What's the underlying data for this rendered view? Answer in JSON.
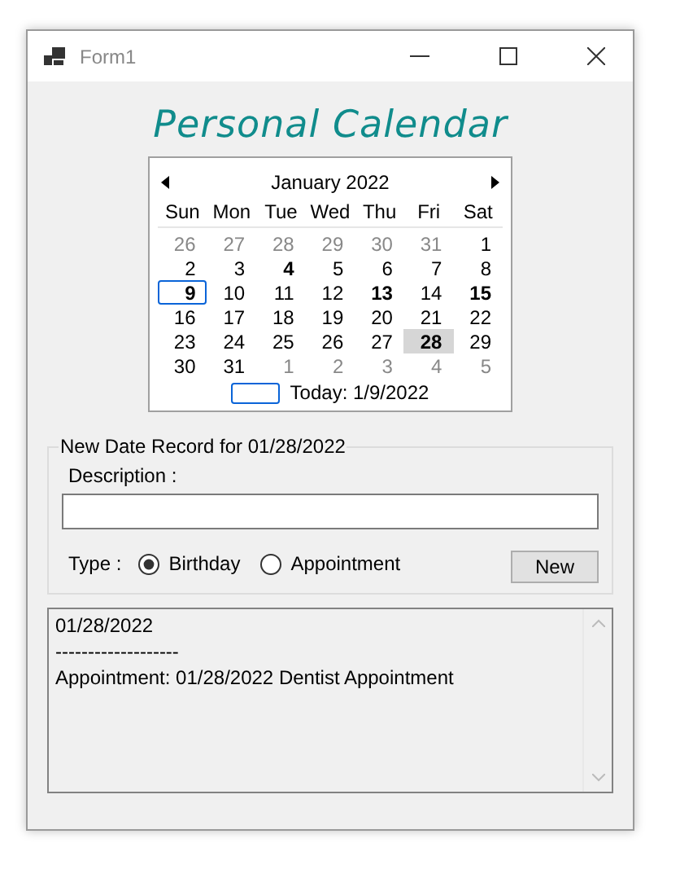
{
  "window": {
    "title": "Form1"
  },
  "heading": "Personal Calendar",
  "calendar": {
    "month": "January 2022",
    "weekdays": [
      "Sun",
      "Mon",
      "Tue",
      "Wed",
      "Thu",
      "Fri",
      "Sat"
    ],
    "days": [
      {
        "label": "26",
        "other_month": true,
        "bold": false,
        "today": false,
        "selected": false
      },
      {
        "label": "27",
        "other_month": true,
        "bold": false,
        "today": false,
        "selected": false
      },
      {
        "label": "28",
        "other_month": true,
        "bold": false,
        "today": false,
        "selected": false
      },
      {
        "label": "29",
        "other_month": true,
        "bold": false,
        "today": false,
        "selected": false
      },
      {
        "label": "30",
        "other_month": true,
        "bold": false,
        "today": false,
        "selected": false
      },
      {
        "label": "31",
        "other_month": true,
        "bold": false,
        "today": false,
        "selected": false
      },
      {
        "label": "1",
        "other_month": false,
        "bold": false,
        "today": false,
        "selected": false
      },
      {
        "label": "2",
        "other_month": false,
        "bold": false,
        "today": false,
        "selected": false
      },
      {
        "label": "3",
        "other_month": false,
        "bold": false,
        "today": false,
        "selected": false
      },
      {
        "label": "4",
        "other_month": false,
        "bold": true,
        "today": false,
        "selected": false
      },
      {
        "label": "5",
        "other_month": false,
        "bold": false,
        "today": false,
        "selected": false
      },
      {
        "label": "6",
        "other_month": false,
        "bold": false,
        "today": false,
        "selected": false
      },
      {
        "label": "7",
        "other_month": false,
        "bold": false,
        "today": false,
        "selected": false
      },
      {
        "label": "8",
        "other_month": false,
        "bold": false,
        "today": false,
        "selected": false
      },
      {
        "label": "9",
        "other_month": false,
        "bold": true,
        "today": true,
        "selected": false
      },
      {
        "label": "10",
        "other_month": false,
        "bold": false,
        "today": false,
        "selected": false
      },
      {
        "label": "11",
        "other_month": false,
        "bold": false,
        "today": false,
        "selected": false
      },
      {
        "label": "12",
        "other_month": false,
        "bold": false,
        "today": false,
        "selected": false
      },
      {
        "label": "13",
        "other_month": false,
        "bold": true,
        "today": false,
        "selected": false
      },
      {
        "label": "14",
        "other_month": false,
        "bold": false,
        "today": false,
        "selected": false
      },
      {
        "label": "15",
        "other_month": false,
        "bold": true,
        "today": false,
        "selected": false
      },
      {
        "label": "16",
        "other_month": false,
        "bold": false,
        "today": false,
        "selected": false
      },
      {
        "label": "17",
        "other_month": false,
        "bold": false,
        "today": false,
        "selected": false
      },
      {
        "label": "18",
        "other_month": false,
        "bold": false,
        "today": false,
        "selected": false
      },
      {
        "label": "19",
        "other_month": false,
        "bold": false,
        "today": false,
        "selected": false
      },
      {
        "label": "20",
        "other_month": false,
        "bold": false,
        "today": false,
        "selected": false
      },
      {
        "label": "21",
        "other_month": false,
        "bold": false,
        "today": false,
        "selected": false
      },
      {
        "label": "22",
        "other_month": false,
        "bold": false,
        "today": false,
        "selected": false
      },
      {
        "label": "23",
        "other_month": false,
        "bold": false,
        "today": false,
        "selected": false
      },
      {
        "label": "24",
        "other_month": false,
        "bold": false,
        "today": false,
        "selected": false
      },
      {
        "label": "25",
        "other_month": false,
        "bold": false,
        "today": false,
        "selected": false
      },
      {
        "label": "26",
        "other_month": false,
        "bold": false,
        "today": false,
        "selected": false
      },
      {
        "label": "27",
        "other_month": false,
        "bold": false,
        "today": false,
        "selected": false
      },
      {
        "label": "28",
        "other_month": false,
        "bold": true,
        "today": false,
        "selected": true
      },
      {
        "label": "29",
        "other_month": false,
        "bold": false,
        "today": false,
        "selected": false
      },
      {
        "label": "30",
        "other_month": false,
        "bold": false,
        "today": false,
        "selected": false
      },
      {
        "label": "31",
        "other_month": false,
        "bold": false,
        "today": false,
        "selected": false
      },
      {
        "label": "1",
        "other_month": true,
        "bold": false,
        "today": false,
        "selected": false
      },
      {
        "label": "2",
        "other_month": true,
        "bold": false,
        "today": false,
        "selected": false
      },
      {
        "label": "3",
        "other_month": true,
        "bold": false,
        "today": false,
        "selected": false
      },
      {
        "label": "4",
        "other_month": true,
        "bold": false,
        "today": false,
        "selected": false
      },
      {
        "label": "5",
        "other_month": true,
        "bold": false,
        "today": false,
        "selected": false
      }
    ],
    "today_label": "Today: 1/9/2022"
  },
  "record_group": {
    "title": "New Date Record for 01/28/2022",
    "description_label": "Description :",
    "type_label": "Type :",
    "types": [
      {
        "label": "Birthday",
        "selected": true
      },
      {
        "label": "Appointment",
        "selected": false
      }
    ],
    "new_button": "New"
  },
  "log_lines": [
    "01/28/2022",
    "-------------------",
    "Appointment: 01/28/2022  Dentist Appointment"
  ]
}
